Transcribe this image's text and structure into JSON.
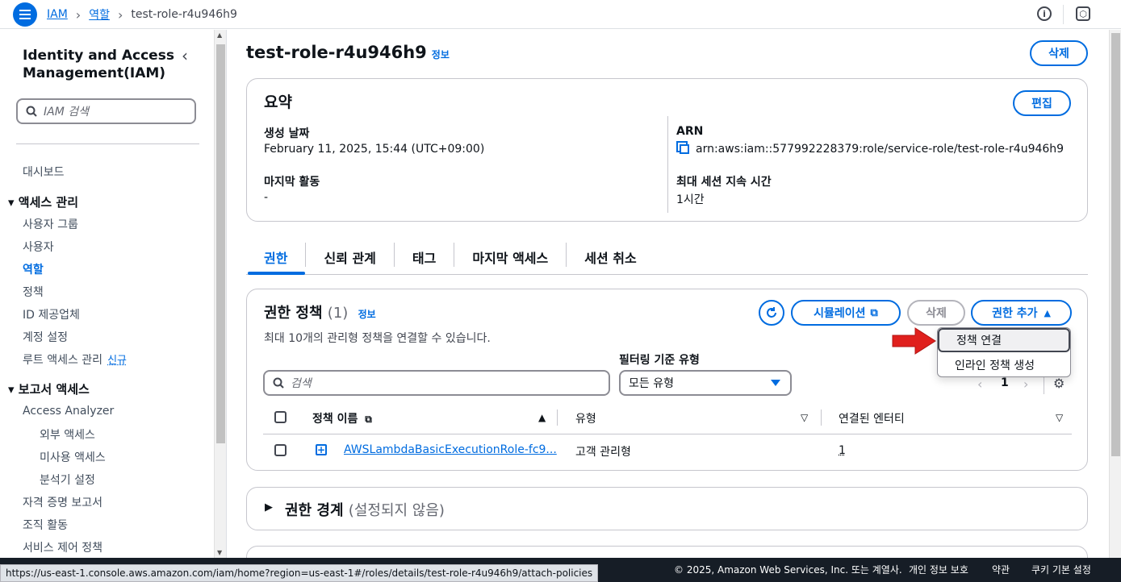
{
  "breadcrumb": {
    "root": "IAM",
    "section": "역할",
    "current": "test-role-r4u946h9"
  },
  "sidebar": {
    "title": "Identity and Access Management(IAM)",
    "search_placeholder": "IAM 검색",
    "dashboard": "대시보드",
    "access_mgmt": "액세스 관리",
    "items": [
      "사용자 그룹",
      "사용자",
      "역할",
      "정책",
      "ID 제공업체",
      "계정 설정",
      "루트 액세스 관리"
    ],
    "new_badge": "신규",
    "reports": "보고서 액세스",
    "analyzer": "Access Analyzer",
    "analyzer_items": [
      "외부 액세스",
      "미사용 액세스",
      "분석기 설정"
    ],
    "more_items": [
      "자격 증명 보고서",
      "조직 활동",
      "서비스 제어 정책"
    ]
  },
  "page": {
    "title": "test-role-r4u946h9",
    "info": "정보",
    "delete_btn": "삭제"
  },
  "summary": {
    "title": "요약",
    "edit_btn": "편집",
    "created_label": "생성 날짜",
    "created_value": "February 11, 2025, 15:44 (UTC+09:00)",
    "arn_label": "ARN",
    "arn_value": "arn:aws:iam::577992228379:role/service-role/test-role-r4u946h9",
    "last_activity_label": "마지막 활동",
    "last_activity_value": "-",
    "max_session_label": "최대 세션 지속 시간",
    "max_session_value": "1시간"
  },
  "tabs": [
    "권한",
    "신뢰 관계",
    "태그",
    "마지막 액세스",
    "세션 취소"
  ],
  "permissions": {
    "title": "권한 정책",
    "count": "(1)",
    "info": "정보",
    "desc": "최대 10개의 관리형 정책을 연결할 수 있습니다.",
    "simulate_btn": "시뮬레이션",
    "delete_btn": "삭제",
    "add_btn": "권한 추가",
    "filter_label": "필터링 기준 유형",
    "search_placeholder": "검색",
    "filter_value": "모든 유형",
    "page_number": "1",
    "columns": [
      "정책 이름",
      "유형",
      "연결된 엔터티"
    ],
    "rows": [
      {
        "name": "AWSLambdaBasicExecutionRole-fc9...",
        "type": "고객 관리형",
        "entities": "1"
      }
    ],
    "dropdown": [
      "정책 연결",
      "인라인 정책 생성"
    ]
  },
  "boundary": {
    "title": "권한 경계",
    "status": "(설정되지 않음)"
  },
  "status_url": "https://us-east-1.console.aws.amazon.com/iam/home?region=us-east-1#/roles/details/test-role-r4u946h9/attach-policies",
  "footer": {
    "copyright": "© 2025, Amazon Web Services, Inc. 또는 계열사.",
    "privacy": "개인 정보 보호",
    "terms": "약관",
    "cookies": "쿠키 기본 설정"
  },
  "colors": {
    "accent": "#006ce0",
    "arrow": "#e0201d",
    "footer_bg": "#161d26"
  }
}
